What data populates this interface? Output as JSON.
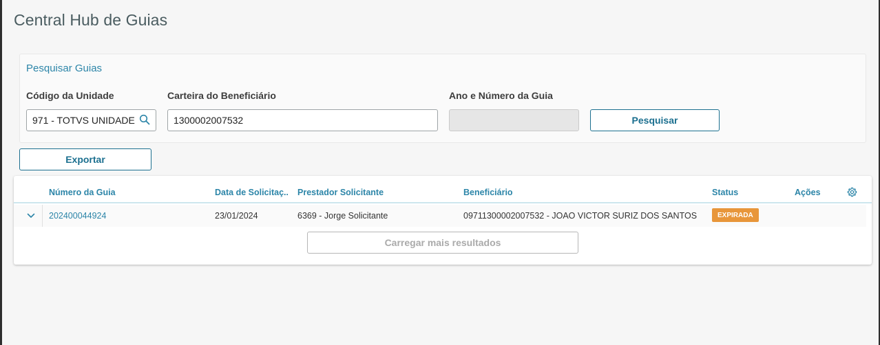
{
  "page": {
    "title": "Central Hub de Guias"
  },
  "search": {
    "panel_title": "Pesquisar Guias",
    "unit_label": "Código da Unidade",
    "unit_value": "971 - TOTVS UNIDADE",
    "beneficiary_label": "Carteira do Beneficiário",
    "beneficiary_value": "1300002007532",
    "guide_label": "Ano e Número da Guia",
    "guide_value": "",
    "search_button": "Pesquisar"
  },
  "toolbar": {
    "export_button": "Exportar"
  },
  "table": {
    "columns": [
      "Número da Guia",
      "Data de Solicitaç...",
      "Prestador Solicitante",
      "Beneficiário",
      "Status",
      "Ações"
    ],
    "rows": [
      {
        "numero": "202400044924",
        "data": "23/01/2024",
        "prestador": "6369 - Jorge Solicitante",
        "beneficiario": "09711300002007532 - JOAO VICTOR SURIZ DOS SANTOS",
        "status": "EXPIRADA"
      }
    ],
    "load_more": "Carregar mais resultados"
  },
  "colors": {
    "accent": "#2c85a8",
    "primary_button": "#1b6f8f",
    "status_expirada": "#e8963a"
  },
  "icons": {
    "search": "search-icon",
    "settings": "gear-icon",
    "expand": "chevron-down-icon"
  }
}
